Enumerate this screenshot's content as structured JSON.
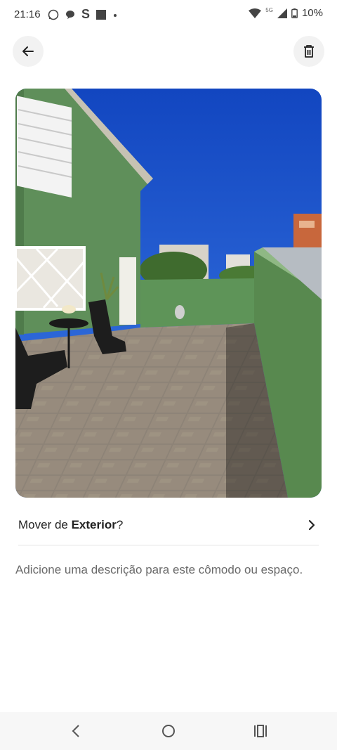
{
  "status": {
    "time": "21:16",
    "network": "5G",
    "battery": "10%"
  },
  "header": {
    "back_icon": "arrow-left-icon",
    "delete_icon": "trash-icon"
  },
  "photo": {
    "description_icon": "terrace-photo"
  },
  "move_row": {
    "prefix": "Mover de ",
    "room": "Exterior",
    "suffix": "?"
  },
  "description": {
    "placeholder": "Adicione uma descrição para este cômodo ou espaço."
  },
  "colors": {
    "wall_green": "#5f8f5a",
    "sky": "#1f5fd6",
    "floor": "#8d8377"
  }
}
